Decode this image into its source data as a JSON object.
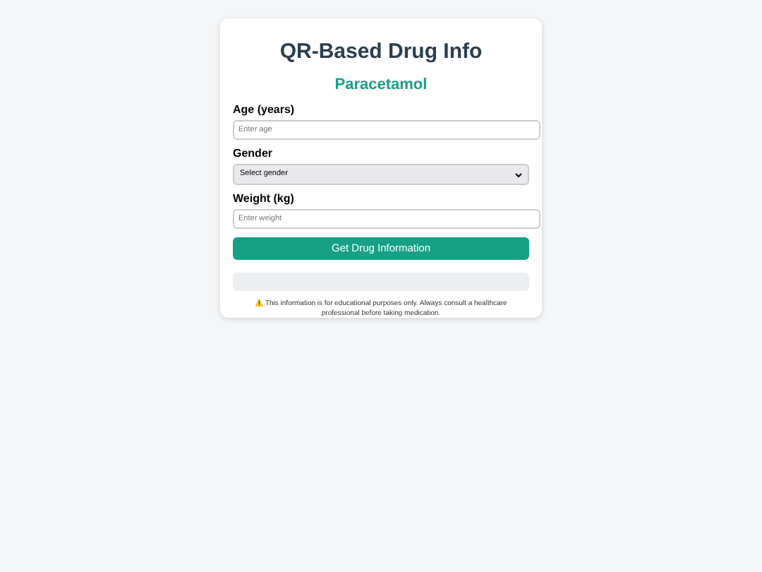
{
  "title": "QR-Based Drug Info",
  "drug": "Paracetamol",
  "fields": [
    {
      "kind": "input",
      "label": "Age (years)",
      "placeholder": "Enter age"
    },
    {
      "kind": "select",
      "label": "Gender",
      "value": "Select gender"
    },
    {
      "kind": "input",
      "label": "Weight (kg)",
      "placeholder": "Enter weight"
    }
  ],
  "button": "Get Drug Information",
  "disclaimer": "⚠️ This information is for educational purposes only. Always consult a healthcare professional before taking medication."
}
